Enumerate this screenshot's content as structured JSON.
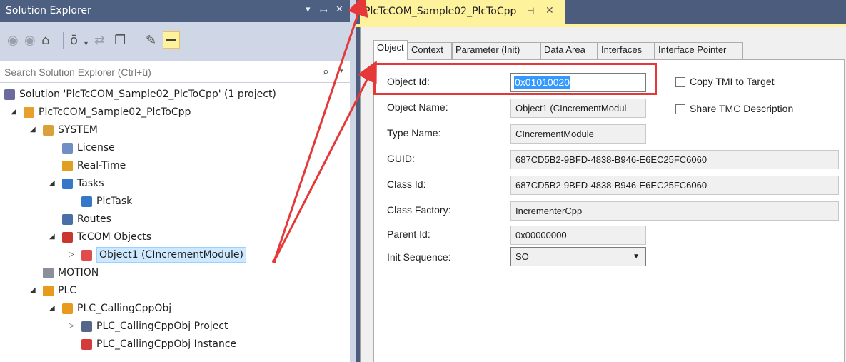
{
  "solution_explorer": {
    "title": "Solution Explorer",
    "title_buttons": [
      "▾",
      "ꟷ",
      "✕"
    ],
    "search_placeholder": "Search Solution Explorer (Ctrl+ü)",
    "tree": [
      {
        "label": "Solution 'PlcTcCOM_Sample02_PlcToCpp' (1 project)",
        "icon": "solution-icon",
        "indent": 0,
        "expander": ""
      },
      {
        "label": "PlcTcCOM_Sample02_PlcToCpp",
        "icon": "project-icon",
        "indent": 1,
        "expander": "◢"
      },
      {
        "label": "SYSTEM",
        "icon": "system-icon",
        "indent": 2,
        "expander": "◢"
      },
      {
        "label": "License",
        "icon": "license-icon",
        "indent": 3,
        "expander": ""
      },
      {
        "label": "Real-Time",
        "icon": "realtime-icon",
        "indent": 3,
        "expander": ""
      },
      {
        "label": "Tasks",
        "icon": "tasks-icon",
        "indent": 3,
        "expander": "◢"
      },
      {
        "label": "PlcTask",
        "icon": "task-icon",
        "indent": 4,
        "expander": ""
      },
      {
        "label": "Routes",
        "icon": "routes-icon",
        "indent": 3,
        "expander": ""
      },
      {
        "label": "TcCOM Objects",
        "icon": "tccom-icon",
        "indent": 3,
        "expander": "◢"
      },
      {
        "label": "Object1 (CIncrementModule)",
        "icon": "tccom-object-icon",
        "indent": 4,
        "expander": "▷",
        "selected": true
      },
      {
        "label": "MOTION",
        "icon": "motion-icon",
        "indent": 2,
        "expander": ""
      },
      {
        "label": "PLC",
        "icon": "plc-icon",
        "indent": 2,
        "expander": "◢"
      },
      {
        "label": "PLC_CallingCppObj",
        "icon": "plc-project-icon",
        "indent": 3,
        "expander": "◢"
      },
      {
        "label": "PLC_CallingCppObj Project",
        "icon": "plc-subproject-icon",
        "indent": 4,
        "expander": "▷"
      },
      {
        "label": "PLC_CallingCppObj Instance",
        "icon": "plc-instance-icon",
        "indent": 4,
        "expander": ""
      }
    ]
  },
  "document": {
    "tab_title": "PlcTcCOM_Sample02_PlcToCpp",
    "tab_pin": "⊣",
    "tab_close": "✕",
    "property_tabs": [
      "Object",
      "Context",
      "Parameter (Init)",
      "Data Area",
      "Interfaces",
      "Interface Pointer"
    ],
    "fields": {
      "object_id": {
        "label": "Object Id:",
        "value": "0x01010020"
      },
      "object_name": {
        "label": "Object Name:",
        "value": "Object1 (CIncrementModul"
      },
      "type_name": {
        "label": "Type Name:",
        "value": "CIncrementModule"
      },
      "guid": {
        "label": "GUID:",
        "value": "687CD5B2-9BFD-4838-B946-E6EC25FC6060"
      },
      "class_id": {
        "label": "Class Id:",
        "value": "687CD5B2-9BFD-4838-B946-E6EC25FC6060"
      },
      "class_factory": {
        "label": "Class Factory:",
        "value": "IncrementerCpp"
      },
      "parent_id": {
        "label": "Parent Id:",
        "value": "0x00000000"
      },
      "init_sequence": {
        "label": "Init Sequence:",
        "value": "SO"
      }
    },
    "checkboxes": {
      "copy_tmi": {
        "label": "Copy TMI to Target",
        "checked": false
      },
      "share_tmc": {
        "label": "Share TMC Description",
        "checked": false
      }
    }
  },
  "colors": {
    "title_bar": "#4d6082",
    "active_doc_tab": "#fff29d",
    "selection": "#cde8ff",
    "annotation_red": "#e53838"
  }
}
